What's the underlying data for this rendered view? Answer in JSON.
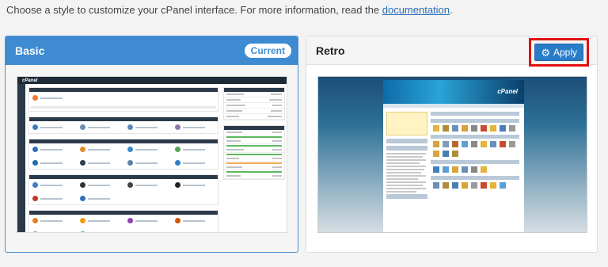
{
  "intro": {
    "text": "Choose a style to customize your cPanel interface. For more information, read the ",
    "link": "documentation",
    "suffix": "."
  },
  "styles": [
    {
      "name": "Basic",
      "badge": "Current",
      "thumbnail_logo": "cPanel"
    },
    {
      "name": "Retro",
      "action": "Apply",
      "action_icon": "gear-icon",
      "thumbnail_logo": "cPanel"
    }
  ],
  "colors": {
    "accent": "#3f8bd1",
    "apply_button": "#2a7cc8",
    "highlight": "#e01010"
  }
}
